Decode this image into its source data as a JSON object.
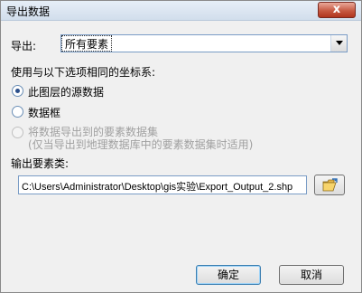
{
  "window": {
    "title": "导出数据",
    "close_label": "x"
  },
  "export": {
    "label": "导出:",
    "selected": "所有要素"
  },
  "coordinate_system": {
    "label": "使用与以下选项相同的坐标系:",
    "options": [
      {
        "label": "此图层的源数据",
        "checked": true,
        "disabled": false
      },
      {
        "label": "数据框",
        "checked": false,
        "disabled": false
      },
      {
        "label": "将数据导出到的要素数据集",
        "sublabel": "(仅当导出到地理数据库中的要素数据集时适用)",
        "checked": false,
        "disabled": true
      }
    ]
  },
  "output": {
    "label": "输出要素类:",
    "path": "C:\\Users\\Administrator\\Desktop\\gis实验\\Export_Output_2.shp"
  },
  "buttons": {
    "ok": "确定",
    "cancel": "取消"
  },
  "icons": {
    "browse": "open-folder-icon",
    "dropdown": "chevron-down-icon",
    "close": "close-icon"
  }
}
